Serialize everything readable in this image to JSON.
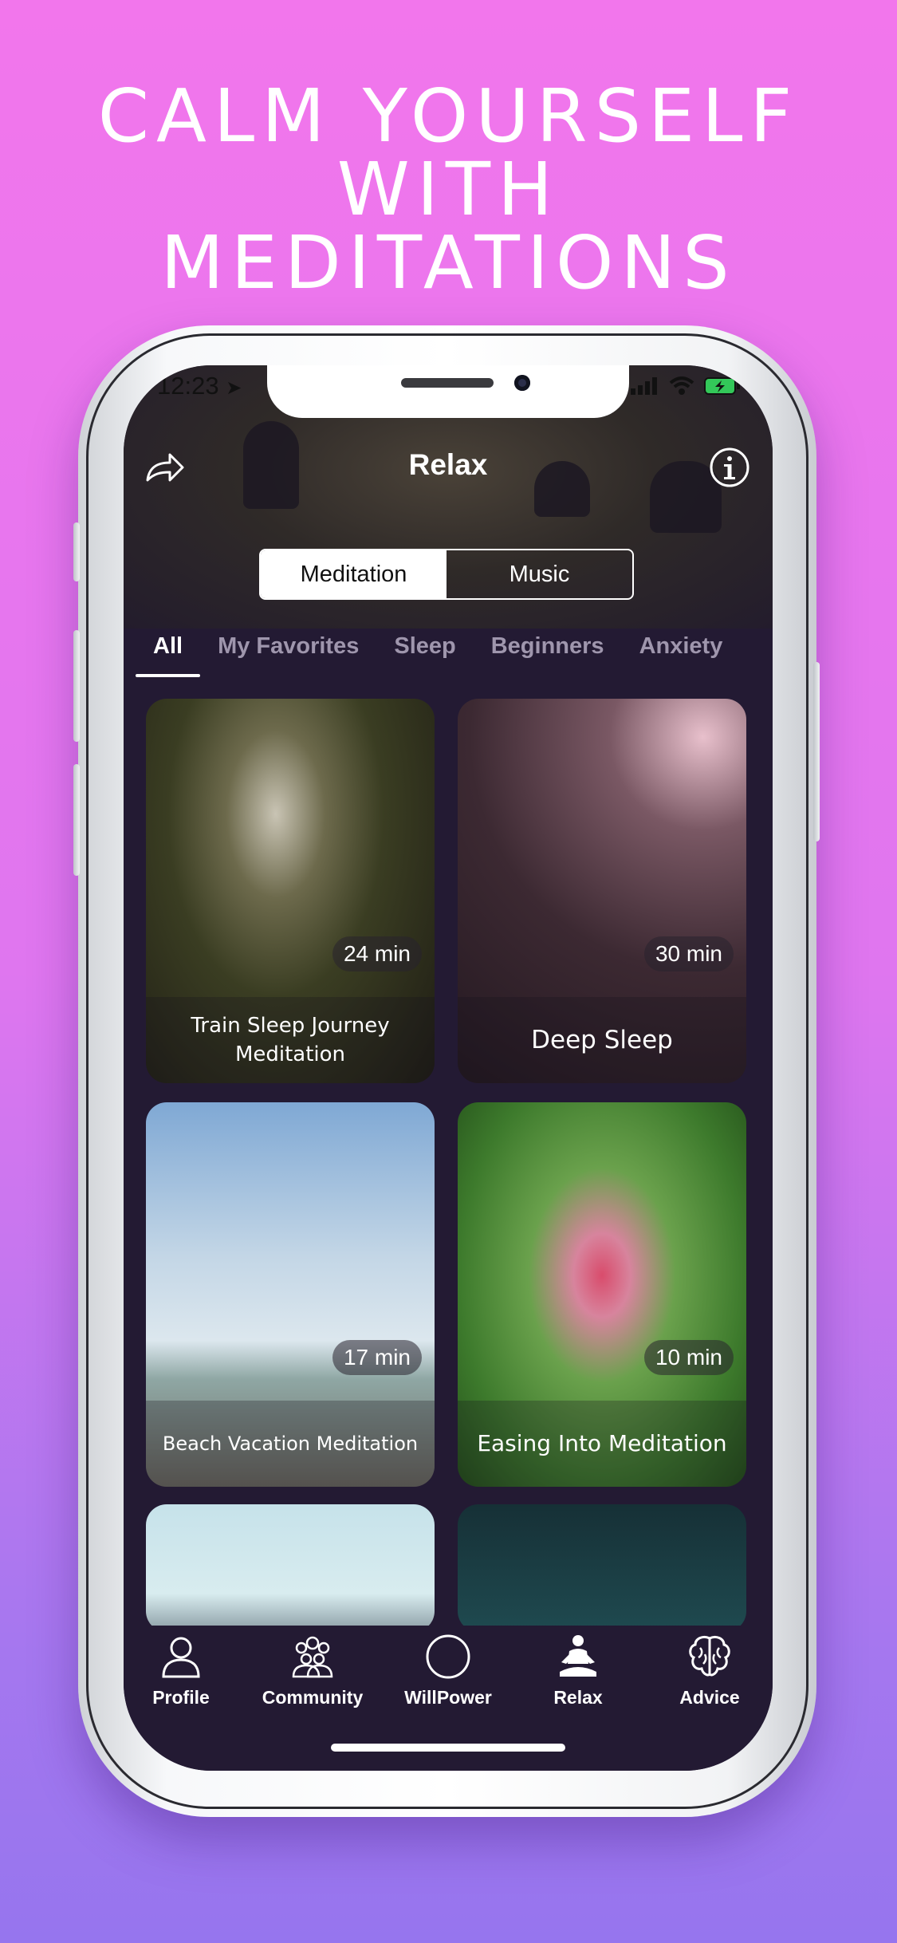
{
  "headline": {
    "line1": "CALM YOURSELF",
    "line2": "WITH",
    "line3": "MEDITATIONS"
  },
  "status_bar": {
    "time": "12:23"
  },
  "nav": {
    "title": "Relax",
    "share_icon": "share-arrow-icon",
    "info_icon": "info-circle-icon"
  },
  "segments": {
    "left": "Meditation",
    "right": "Music",
    "selected": "Meditation"
  },
  "categories": [
    "All",
    "My Favorites",
    "Sleep",
    "Beginners",
    "Anxiety"
  ],
  "selected_category": "All",
  "cards": [
    {
      "title": "Train Sleep Journey Meditation",
      "duration": "24 min"
    },
    {
      "title": "Deep Sleep",
      "duration": "30 min"
    },
    {
      "title": "Beach Vacation Meditation",
      "duration": "17 min"
    },
    {
      "title": "Easing Into Meditation",
      "duration": "10 min"
    }
  ],
  "tabbar": [
    {
      "label": "Profile",
      "icon": "person-icon"
    },
    {
      "label": "Community",
      "icon": "group-icon"
    },
    {
      "label": "WillPower",
      "icon": "circle-icon"
    },
    {
      "label": "Relax",
      "icon": "meditation-icon"
    },
    {
      "label": "Advice",
      "icon": "brain-icon"
    }
  ],
  "colors": {
    "bg_top": "#f276ec",
    "bg_bottom": "#9675ee",
    "app_bg": "#231a33",
    "battery": "#33c759"
  }
}
